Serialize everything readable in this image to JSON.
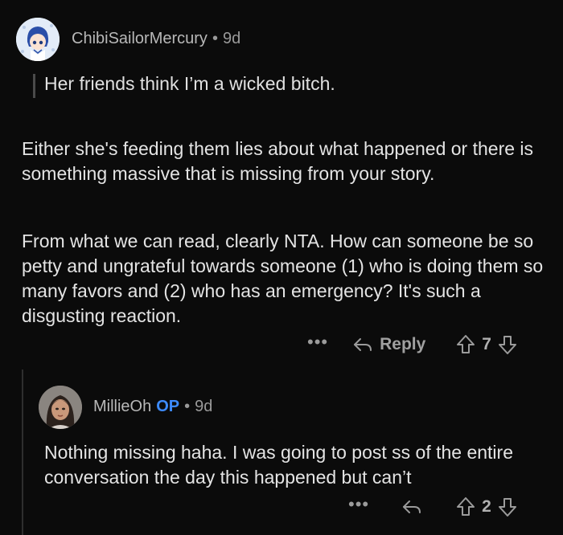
{
  "comment": {
    "author": "ChibiSailorMercury",
    "separator": "•",
    "age": "9d",
    "quote": "Her friends think I’m a wicked bitch.",
    "paragraphs": [
      "Either she's feeding them lies about what happened or there is something massive that is missing from your story.",
      "From what we can read, clearly NTA. How can someone be so petty and ungrateful towards someone (1) who is doing them so many favors and (2) who has an emergency? It's such a disgusting reaction."
    ],
    "actions": {
      "more": "•••",
      "reply_label": "Reply",
      "vote_count": "7"
    }
  },
  "reply": {
    "author": "MillieOh",
    "op_badge": "OP",
    "separator": "•",
    "age": "9d",
    "text": "Nothing missing haha. I was going to post ss of the entire conversation the day this happened but can’t",
    "actions": {
      "more": "•••",
      "vote_count": "2"
    }
  },
  "icons": {
    "reply": "reply-arrow-icon",
    "upvote": "upvote-arrow-icon",
    "downvote": "downvote-arrow-icon",
    "more": "more-dots-icon"
  },
  "colors": {
    "background": "#0b0b0b",
    "op_badge": "#3d8bfd",
    "muted": "#9a9a9a"
  }
}
